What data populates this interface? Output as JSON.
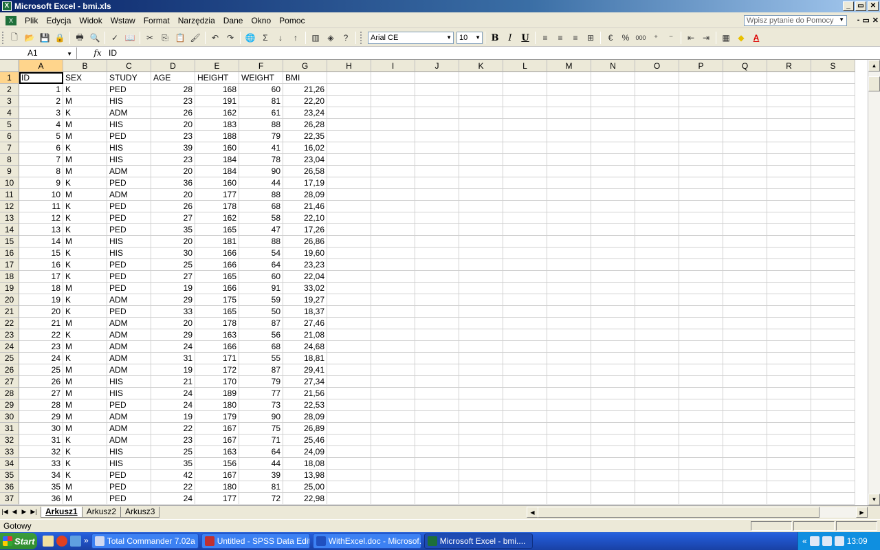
{
  "window": {
    "title": "Microsoft Excel - bmi.xls",
    "controls": [
      "_",
      "▭",
      "✕"
    ]
  },
  "menu": {
    "items": [
      "Plik",
      "Edycja",
      "Widok",
      "Wstaw",
      "Format",
      "Narzędzia",
      "Dane",
      "Okno",
      "Pomoc"
    ],
    "help_placeholder": "Wpisz pytanie do Pomocy",
    "doc_controls": [
      "-",
      "▭",
      "✕"
    ]
  },
  "toolbar": {
    "font": "Arial CE",
    "size": "10",
    "bold": "B",
    "italic": "I",
    "underline": "U",
    "percent": "%",
    "thousands": "000",
    "font_color": "A",
    "sigma": "Σ"
  },
  "formula_bar": {
    "name_box": "A1",
    "fx": "fx",
    "value": "ID"
  },
  "sheet": {
    "columns": [
      "A",
      "B",
      "C",
      "D",
      "E",
      "F",
      "G",
      "H",
      "I",
      "J",
      "K",
      "L",
      "M",
      "N",
      "O",
      "P",
      "Q",
      "R",
      "S"
    ],
    "numeric_cols": [
      0,
      3,
      4,
      5,
      6
    ],
    "rows": [
      [
        "ID",
        "SEX",
        "STUDY",
        "AGE",
        "HEIGHT",
        "WEIGHT",
        "BMI"
      ],
      [
        "1",
        "K",
        "PED",
        "28",
        "168",
        "60",
        "21,26"
      ],
      [
        "2",
        "M",
        "HIS",
        "23",
        "191",
        "81",
        "22,20"
      ],
      [
        "3",
        "K",
        "ADM",
        "26",
        "162",
        "61",
        "23,24"
      ],
      [
        "4",
        "M",
        "HIS",
        "20",
        "183",
        "88",
        "26,28"
      ],
      [
        "5",
        "M",
        "PED",
        "23",
        "188",
        "79",
        "22,35"
      ],
      [
        "6",
        "K",
        "HIS",
        "39",
        "160",
        "41",
        "16,02"
      ],
      [
        "7",
        "M",
        "HIS",
        "23",
        "184",
        "78",
        "23,04"
      ],
      [
        "8",
        "M",
        "ADM",
        "20",
        "184",
        "90",
        "26,58"
      ],
      [
        "9",
        "K",
        "PED",
        "36",
        "160",
        "44",
        "17,19"
      ],
      [
        "10",
        "M",
        "ADM",
        "20",
        "177",
        "88",
        "28,09"
      ],
      [
        "11",
        "K",
        "PED",
        "26",
        "178",
        "68",
        "21,46"
      ],
      [
        "12",
        "K",
        "PED",
        "27",
        "162",
        "58",
        "22,10"
      ],
      [
        "13",
        "K",
        "PED",
        "35",
        "165",
        "47",
        "17,26"
      ],
      [
        "14",
        "M",
        "HIS",
        "20",
        "181",
        "88",
        "26,86"
      ],
      [
        "15",
        "K",
        "HIS",
        "30",
        "166",
        "54",
        "19,60"
      ],
      [
        "16",
        "K",
        "PED",
        "25",
        "166",
        "64",
        "23,23"
      ],
      [
        "17",
        "K",
        "PED",
        "27",
        "165",
        "60",
        "22,04"
      ],
      [
        "18",
        "M",
        "PED",
        "19",
        "166",
        "91",
        "33,02"
      ],
      [
        "19",
        "K",
        "ADM",
        "29",
        "175",
        "59",
        "19,27"
      ],
      [
        "20",
        "K",
        "PED",
        "33",
        "165",
        "50",
        "18,37"
      ],
      [
        "21",
        "M",
        "ADM",
        "20",
        "178",
        "87",
        "27,46"
      ],
      [
        "22",
        "K",
        "ADM",
        "29",
        "163",
        "56",
        "21,08"
      ],
      [
        "23",
        "M",
        "ADM",
        "24",
        "166",
        "68",
        "24,68"
      ],
      [
        "24",
        "K",
        "ADM",
        "31",
        "171",
        "55",
        "18,81"
      ],
      [
        "25",
        "M",
        "ADM",
        "19",
        "172",
        "87",
        "29,41"
      ],
      [
        "26",
        "M",
        "HIS",
        "21",
        "170",
        "79",
        "27,34"
      ],
      [
        "27",
        "M",
        "HIS",
        "24",
        "189",
        "77",
        "21,56"
      ],
      [
        "28",
        "M",
        "PED",
        "24",
        "180",
        "73",
        "22,53"
      ],
      [
        "29",
        "M",
        "ADM",
        "19",
        "179",
        "90",
        "28,09"
      ],
      [
        "30",
        "M",
        "ADM",
        "22",
        "167",
        "75",
        "26,89"
      ],
      [
        "31",
        "K",
        "ADM",
        "23",
        "167",
        "71",
        "25,46"
      ],
      [
        "32",
        "K",
        "HIS",
        "25",
        "163",
        "64",
        "24,09"
      ],
      [
        "33",
        "K",
        "HIS",
        "35",
        "156",
        "44",
        "18,08"
      ],
      [
        "34",
        "K",
        "PED",
        "42",
        "167",
        "39",
        "13,98"
      ],
      [
        "35",
        "M",
        "PED",
        "22",
        "180",
        "81",
        "25,00"
      ],
      [
        "36",
        "M",
        "PED",
        "24",
        "177",
        "72",
        "22,98"
      ]
    ]
  },
  "sheet_tabs": {
    "items": [
      "Arkusz1",
      "Arkusz2",
      "Arkusz3"
    ],
    "active": "Arkusz1"
  },
  "status": {
    "text": "Gotowy"
  },
  "taskbar": {
    "start": "Start",
    "chevron": "»",
    "tasks": [
      "Total Commander 7.02a ...",
      "Untitled - SPSS Data Editor",
      "WithExcel.doc - Microsof...",
      "Microsoft Excel - bmi...."
    ],
    "active_task": 3,
    "tray_chevron": "«",
    "time": "13:09"
  }
}
